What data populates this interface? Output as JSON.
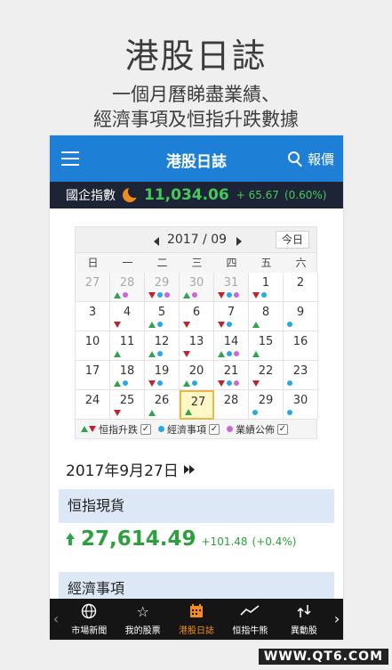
{
  "promo": {
    "title": "港股日誌",
    "line1": "一個月曆睇盡業績、",
    "line2": "經濟事項及恒指升跌數據"
  },
  "appbar": {
    "title": "港股日誌",
    "quote_label": "報價",
    "color": "#1e7fd6"
  },
  "ticker": {
    "name": "國企指數",
    "value": "11,034.06",
    "change": "+ 65.67",
    "percent": "(0.60%)"
  },
  "calendar": {
    "month_label": "2017 / 09",
    "today_label": "今日",
    "weekdays": [
      "日",
      "一",
      "二",
      "三",
      "四",
      "五",
      "六"
    ],
    "days": [
      {
        "day": "27",
        "other": true,
        "marks": []
      },
      {
        "day": "28",
        "other": true,
        "marks": [
          "up",
          "earn"
        ]
      },
      {
        "day": "29",
        "other": true,
        "marks": [
          "down",
          "econ",
          "earn"
        ]
      },
      {
        "day": "30",
        "other": true,
        "marks": [
          "up",
          "earn"
        ]
      },
      {
        "day": "31",
        "other": true,
        "marks": [
          "down",
          "econ",
          "earn"
        ]
      },
      {
        "day": "1",
        "other": false,
        "marks": [
          "down",
          "econ"
        ]
      },
      {
        "day": "2",
        "other": false,
        "marks": []
      },
      {
        "day": "3",
        "other": false,
        "marks": []
      },
      {
        "day": "4",
        "other": false,
        "marks": [
          "down"
        ]
      },
      {
        "day": "5",
        "other": false,
        "marks": [
          "up",
          "econ"
        ]
      },
      {
        "day": "6",
        "other": false,
        "marks": [
          "down"
        ]
      },
      {
        "day": "7",
        "other": false,
        "marks": [
          "down",
          "econ"
        ]
      },
      {
        "day": "8",
        "other": false,
        "marks": [
          "up"
        ]
      },
      {
        "day": "9",
        "other": false,
        "marks": [
          "econ"
        ]
      },
      {
        "day": "10",
        "other": false,
        "marks": []
      },
      {
        "day": "11",
        "other": false,
        "marks": [
          "up"
        ]
      },
      {
        "day": "12",
        "other": false,
        "marks": [
          "up",
          "econ"
        ]
      },
      {
        "day": "13",
        "other": false,
        "marks": [
          "down"
        ]
      },
      {
        "day": "14",
        "other": false,
        "marks": [
          "up",
          "econ",
          "earn"
        ]
      },
      {
        "day": "15",
        "other": false,
        "marks": [
          "up"
        ]
      },
      {
        "day": "16",
        "other": false,
        "marks": []
      },
      {
        "day": "17",
        "other": false,
        "marks": []
      },
      {
        "day": "18",
        "other": false,
        "marks": [
          "up",
          "econ"
        ]
      },
      {
        "day": "19",
        "other": false,
        "marks": [
          "down",
          "econ"
        ]
      },
      {
        "day": "20",
        "other": false,
        "marks": [
          "up",
          "econ"
        ]
      },
      {
        "day": "21",
        "other": false,
        "marks": [
          "down",
          "econ",
          "earn"
        ]
      },
      {
        "day": "22",
        "other": false,
        "marks": [
          "down"
        ]
      },
      {
        "day": "23",
        "other": false,
        "marks": [
          "econ"
        ]
      },
      {
        "day": "24",
        "other": false,
        "marks": []
      },
      {
        "day": "25",
        "other": false,
        "marks": [
          "down"
        ]
      },
      {
        "day": "26",
        "other": false,
        "marks": [
          "up"
        ]
      },
      {
        "day": "27",
        "other": false,
        "today": true,
        "marks": [
          "up"
        ]
      },
      {
        "day": "28",
        "other": false,
        "marks": []
      },
      {
        "day": "29",
        "other": false,
        "marks": [
          "econ"
        ]
      },
      {
        "day": "30",
        "other": false,
        "marks": [
          "econ"
        ]
      }
    ],
    "legend": {
      "index_move": "恒指升跌",
      "econ_events": "經濟事項",
      "earnings": "業績公佈"
    },
    "colors": {
      "up": "#2ea44f",
      "down": "#c2212b",
      "econ": "#29a8e8",
      "earn": "#cc66d9",
      "today_bg": "#fff7c5"
    }
  },
  "detail": {
    "date_heading": "2017年9月27日",
    "section1": "恒指現貨",
    "value": "27,614.49",
    "change": "+101.48",
    "percent": "(+0.4%)",
    "section2": "經濟事項"
  },
  "nav": {
    "items": [
      {
        "label": "市場新聞",
        "icon": "globe-icon"
      },
      {
        "label": "我的股票",
        "icon": "star-icon"
      },
      {
        "label": "港股日誌",
        "icon": "calendar-icon",
        "active": true
      },
      {
        "label": "恒指牛熊",
        "icon": "chart-icon"
      },
      {
        "label": "異動股",
        "icon": "flow-icon"
      }
    ]
  },
  "watermark": "WWW.QT6.COM"
}
